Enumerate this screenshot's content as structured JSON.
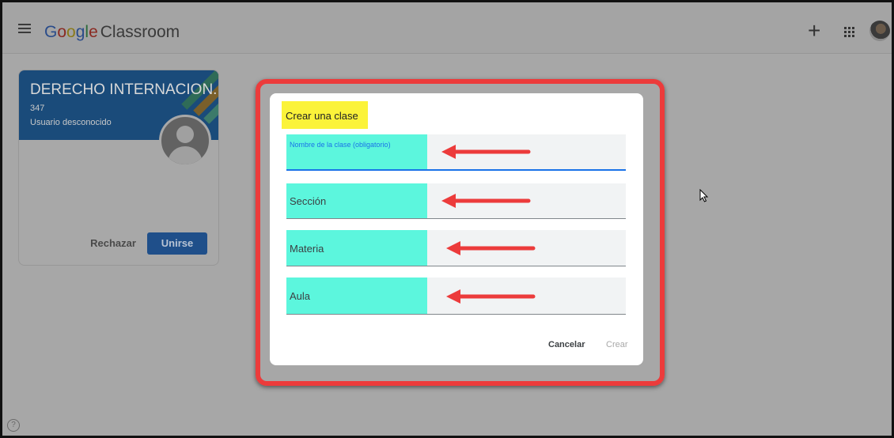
{
  "header": {
    "brand_letters": [
      "G",
      "o",
      "o",
      "g",
      "l",
      "e"
    ],
    "brand_word": "Classroom",
    "icons": [
      "menu-icon",
      "plus-icon",
      "apps-grid-icon",
      "account-avatar"
    ]
  },
  "class_card": {
    "title": "DERECHO INTERNACION...",
    "code": "347",
    "owner": "Usuario desconocido",
    "reject_label": "Rechazar",
    "join_label": "Unirse",
    "join_color": "#1f4f8a"
  },
  "dialog": {
    "title": "Crear una clase",
    "fields": [
      {
        "label": "Nombre de la clase (obligatorio)"
      },
      {
        "label": "Sección"
      },
      {
        "label": "Materia"
      },
      {
        "label": "Aula"
      }
    ],
    "cancel_label": "Cancelar",
    "create_label": "Crear"
  },
  "annotations": {
    "highlight_color": "#ec3b3b",
    "title_highlight": "#fbf33a",
    "field_highlight": "#5cf6dd",
    "arrow_color": "#ec3b3b"
  },
  "footer": {
    "help_glyph": "?"
  }
}
